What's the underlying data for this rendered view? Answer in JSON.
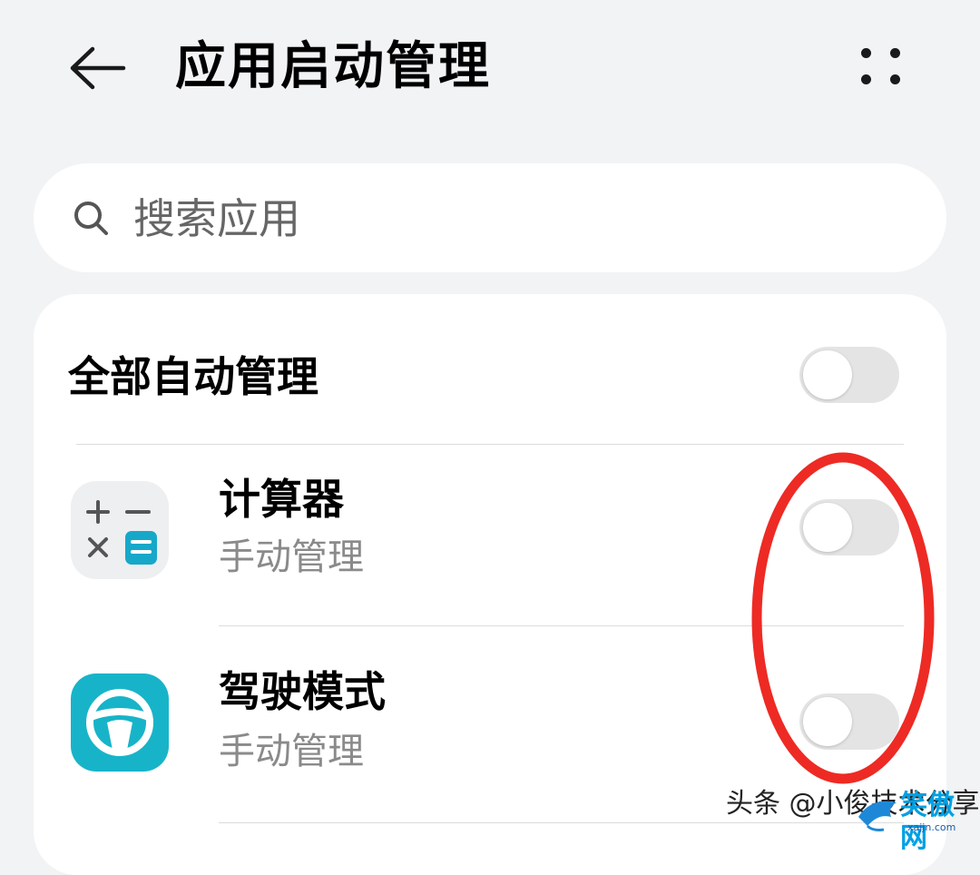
{
  "header": {
    "title": "应用启动管理",
    "back_icon": "arrow-left-icon",
    "more_icon": "more-dots-icon"
  },
  "search": {
    "placeholder": "搜索应用",
    "icon": "search-icon"
  },
  "main_toggle": {
    "label": "全部自动管理",
    "on": false
  },
  "apps": [
    {
      "name": "计算器",
      "mode": "手动管理",
      "icon": "calculator-icon",
      "toggle_on": false
    },
    {
      "name": "驾驶模式",
      "mode": "手动管理",
      "icon": "steering-wheel-icon",
      "toggle_on": false
    }
  ],
  "watermark": "头条 @小俊技术分享",
  "site_logo": {
    "name": "笑傲网",
    "domain": "xajjn.com"
  },
  "colors": {
    "background": "#f1f3f5",
    "annotation": "#ee2a24",
    "driving_icon": "#17b4c9",
    "toggle_off": "#e4e4e4"
  }
}
